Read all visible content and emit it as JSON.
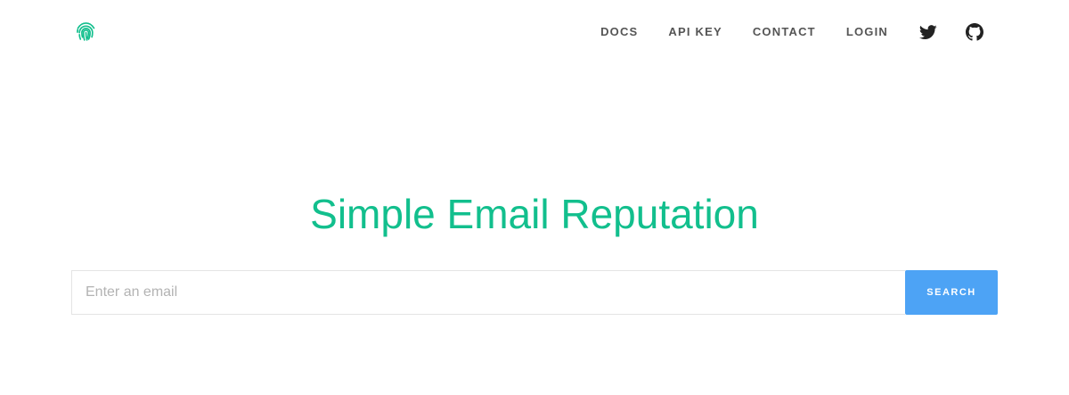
{
  "header": {
    "logo_icon": "fingerprint-icon",
    "nav": {
      "docs": "DOCS",
      "api_key": "API KEY",
      "contact": "CONTACT",
      "login": "LOGIN"
    },
    "social": {
      "twitter_icon": "twitter-icon",
      "github_icon": "github-icon"
    }
  },
  "hero": {
    "title": "Simple Email Reputation"
  },
  "search": {
    "placeholder": "Enter an email",
    "value": "",
    "button_label": "SEARCH"
  },
  "colors": {
    "accent": "#12bf8d",
    "button": "#4da3f5",
    "nav_text": "#555555"
  }
}
